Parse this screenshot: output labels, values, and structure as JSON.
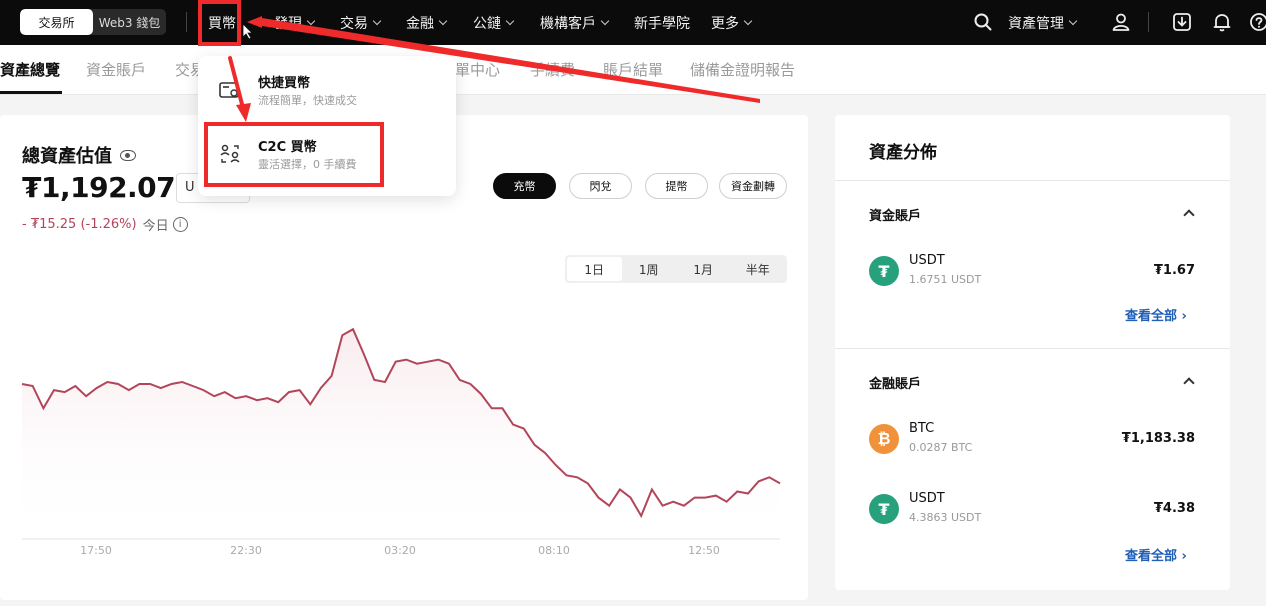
{
  "topnav": {
    "seg": [
      "交易所",
      "Web3 錢包"
    ],
    "items": [
      {
        "label": "買幣",
        "chev": false
      },
      {
        "label": "發現",
        "chev": true
      },
      {
        "label": "交易",
        "chev": true
      },
      {
        "label": "金融",
        "chev": true
      },
      {
        "label": "公鏈",
        "chev": true
      },
      {
        "label": "機構客戶",
        "chev": true
      },
      {
        "label": "新手學院",
        "chev": false
      },
      {
        "label": "更多",
        "chev": true
      }
    ],
    "asset_mgmt": "資產管理"
  },
  "subnav": [
    "資產總覽",
    "資金賬戶",
    "交易",
    "訂單中心",
    "手續費",
    "賬戶結單",
    "儲備金證明報告"
  ],
  "dropdown": [
    {
      "title": "快捷買幣",
      "desc": "流程簡單，快速成交"
    },
    {
      "title": "C2C 買幣",
      "desc": "靈活選擇，0 手續費"
    }
  ],
  "overview": {
    "title": "總資產估值",
    "amount": "₮1,192.07",
    "unit": "U",
    "change": "- ₮15.25 (-1.26%)",
    "today": "今日",
    "buttons": [
      "充幣",
      "閃兌",
      "提幣",
      "資金劃轉"
    ],
    "ranges": [
      "1日",
      "1周",
      "1月",
      "半年"
    ]
  },
  "chart_data": {
    "type": "line",
    "series": [
      {
        "values": [
          1206,
          1205,
          1194,
          1203,
          1202,
          1205,
          1200,
          1204,
          1207,
          1206,
          1203,
          1206,
          1206,
          1204,
          1206,
          1207,
          1205,
          1203,
          1200,
          1202,
          1199,
          1200,
          1198,
          1199,
          1197,
          1202,
          1203,
          1196,
          1204,
          1210,
          1230,
          1233,
          1221,
          1208,
          1207,
          1217,
          1218,
          1216,
          1217,
          1218,
          1216,
          1208,
          1206,
          1201,
          1194,
          1194,
          1186,
          1184,
          1176,
          1172,
          1166,
          1161,
          1160,
          1157,
          1150,
          1146,
          1154,
          1150,
          1141,
          1154,
          1146,
          1148,
          1146,
          1150,
          1150,
          1151,
          1148,
          1153,
          1152,
          1158,
          1160,
          1157
        ]
      }
    ],
    "x_ticks": [
      "17:50",
      "22:30",
      "03:20",
      "08:10",
      "12:50"
    ],
    "grid": false,
    "colors": {
      "line": "#b3455a",
      "fill_top": "#f7e9ec"
    }
  },
  "distribution": {
    "title": "資產分佈",
    "sections": [
      {
        "name": "資金賬戶",
        "assets": [
          {
            "icon": "tether-icon",
            "name": "USDT",
            "amount": "1.6751 USDT",
            "value": "₮1.67"
          }
        ],
        "view_all": "查看全部 ›"
      },
      {
        "name": "金融賬戶",
        "assets": [
          {
            "icon": "bitcoin-icon",
            "name": "BTC",
            "amount": "0.0287 BTC",
            "value": "₮1,183.38"
          },
          {
            "icon": "tether-icon",
            "name": "USDT",
            "amount": "4.3863 USDT",
            "value": "₮4.38"
          }
        ],
        "view_all": "查看全部 ›"
      }
    ]
  },
  "colors": {
    "nav_bg": "#0b0b0b",
    "negative": "#b3455a",
    "link": "#1f5fb5",
    "annotation": "#ef2a2a"
  }
}
